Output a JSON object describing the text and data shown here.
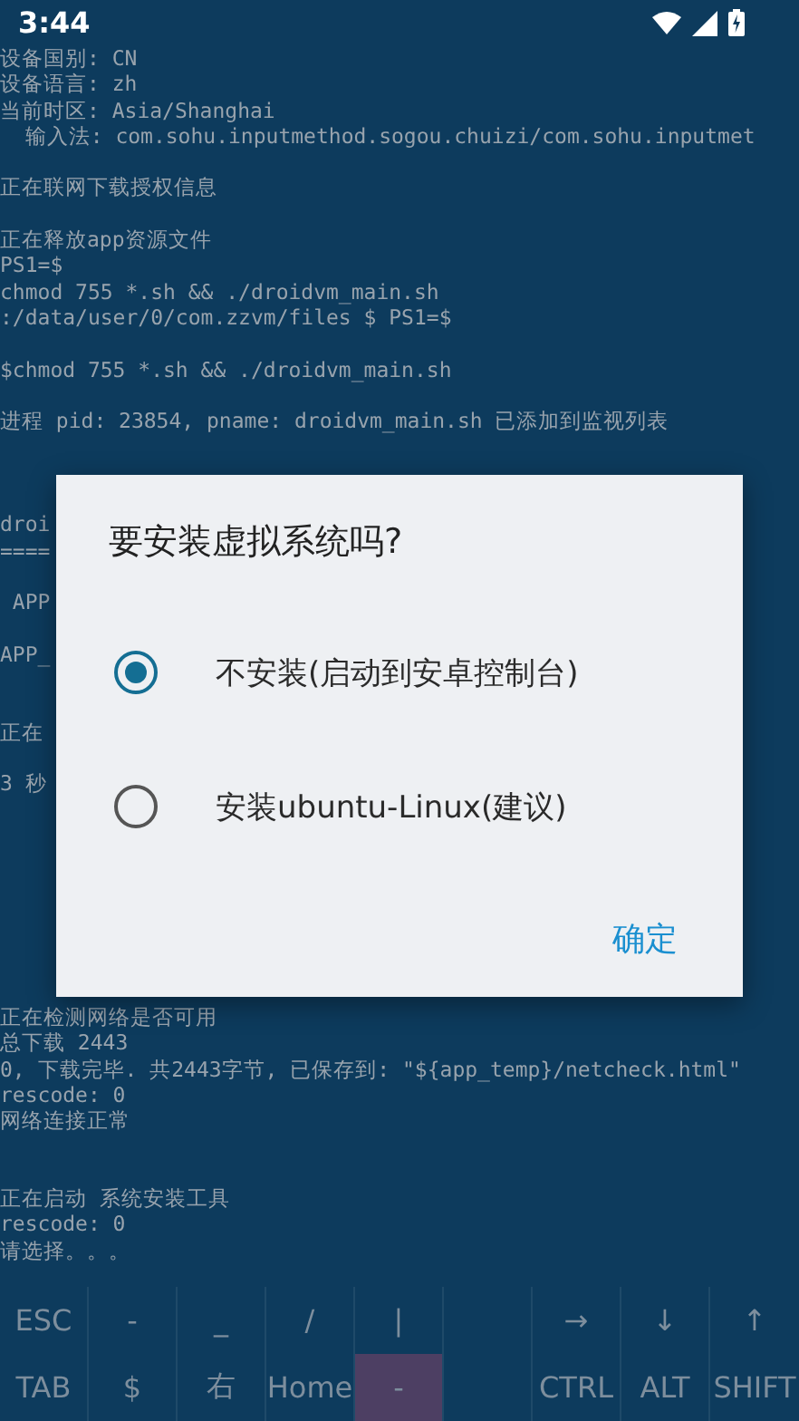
{
  "status_bar": {
    "time": "3:44"
  },
  "terminal": {
    "lines": [
      {
        "kind": "text",
        "text": "设备国别: CN"
      },
      {
        "kind": "text",
        "text": "设备语言: zh"
      },
      {
        "kind": "text",
        "text": "当前时区: Asia/Shanghai"
      },
      {
        "kind": "text",
        "text": "  输入法: com.sohu.inputmethod.sogou.chuizi/com.sohu.inputmet"
      },
      {
        "kind": "blank"
      },
      {
        "kind": "text",
        "text": "正在联网下载授权信息"
      },
      {
        "kind": "blank"
      },
      {
        "kind": "text",
        "text": "正在释放app资源文件"
      },
      {
        "kind": "text",
        "text": "PS1=$"
      },
      {
        "kind": "text",
        "text": "chmod 755 *.sh && ./droidvm_main.sh"
      },
      {
        "kind": "text",
        "text": ":/data/user/0/com.zzvm/files $ PS1=$"
      },
      {
        "kind": "blank"
      },
      {
        "kind": "text",
        "text": "$chmod 755 *.sh && ./droidvm_main.sh"
      },
      {
        "kind": "blank"
      },
      {
        "kind": "text",
        "text": "进程 pid: 23854, pname: droidvm_main.sh 已添加到监视列表"
      },
      {
        "kind": "blank"
      },
      {
        "kind": "blank"
      },
      {
        "kind": "blank"
      },
      {
        "kind": "text",
        "text": "droi"
      },
      {
        "kind": "text",
        "text": "===="
      },
      {
        "kind": "blank"
      },
      {
        "kind": "text",
        "text": " APP"
      },
      {
        "kind": "blank"
      },
      {
        "kind": "text",
        "text": "APP_"
      },
      {
        "kind": "blank"
      },
      {
        "kind": "blank"
      },
      {
        "kind": "text",
        "text": "正在"
      },
      {
        "kind": "blank"
      },
      {
        "kind": "text",
        "text": "3 秒"
      },
      {
        "kind": "blank"
      },
      {
        "kind": "blank"
      },
      {
        "kind": "blank"
      },
      {
        "kind": "blank"
      },
      {
        "kind": "blank"
      },
      {
        "kind": "blank"
      },
      {
        "kind": "blank"
      },
      {
        "kind": "blank"
      },
      {
        "kind": "text",
        "text": "正在检测网络是否可用"
      },
      {
        "kind": "text",
        "text": "总下载 2443"
      },
      {
        "kind": "text",
        "text": "0, 下载完毕. 共2443字节, 已保存到: \"${app_temp}/netcheck.html\""
      },
      {
        "kind": "text",
        "text": "rescode: 0"
      },
      {
        "kind": "text",
        "text": "网络连接正常"
      },
      {
        "kind": "blank"
      },
      {
        "kind": "blank"
      },
      {
        "kind": "text",
        "text": "正在启动 系统安装工具"
      },
      {
        "kind": "text",
        "text": "rescode: 0"
      },
      {
        "kind": "text",
        "text": "请选择。。。"
      }
    ]
  },
  "dialog": {
    "title": "要安装虚拟系统吗?",
    "options": [
      {
        "label": "不安装(启动到安卓控制台)",
        "selected": true
      },
      {
        "label": "安装ubuntu-Linux(建议)",
        "selected": false
      }
    ],
    "button": "确定"
  },
  "extra_keys": [
    [
      {
        "label": "ESC",
        "pressed": false
      },
      {
        "label": "-",
        "pressed": false
      },
      {
        "label": "_",
        "pressed": false
      },
      {
        "label": "/",
        "pressed": false
      },
      {
        "label": "|",
        "pressed": false
      },
      {
        "pressed": false
      },
      {
        "label": "→",
        "pressed": false
      },
      {
        "label": "↓",
        "pressed": false
      },
      {
        "label": "↑",
        "pressed": false
      }
    ],
    [
      {
        "label": "TAB",
        "pressed": false
      },
      {
        "label": "$",
        "pressed": false
      },
      {
        "label": "右",
        "pressed": false
      },
      {
        "label": "Home",
        "pressed": false
      },
      {
        "label": "-",
        "pressed": true
      },
      {
        "pressed": false
      },
      {
        "label": "CTRL",
        "pressed": false
      },
      {
        "label": "ALT",
        "pressed": false
      },
      {
        "label": "SHIFT",
        "pressed": false
      }
    ]
  ]
}
